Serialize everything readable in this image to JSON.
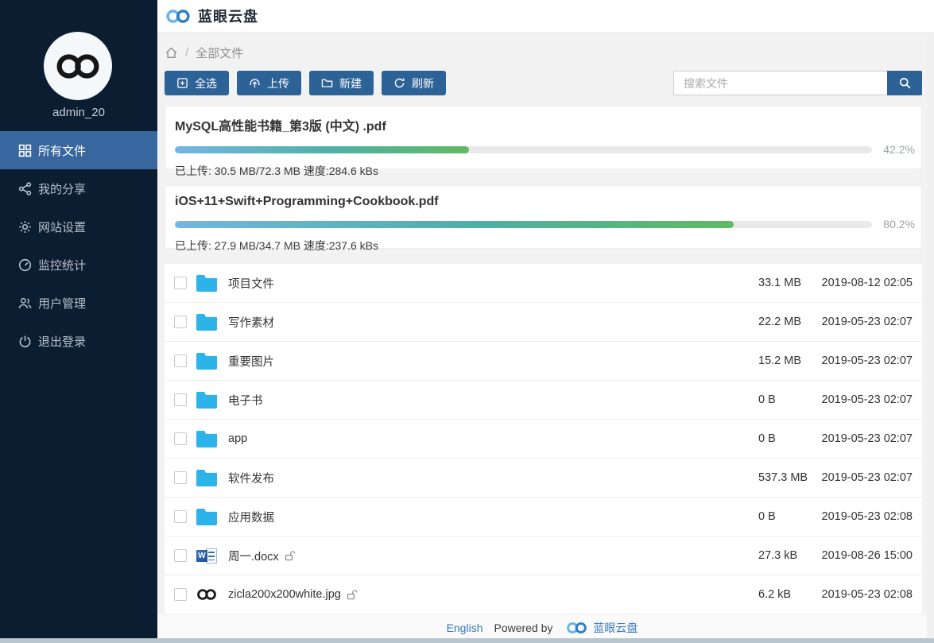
{
  "app": {
    "title": "蓝眼云盘"
  },
  "sidebar": {
    "username": "admin_20",
    "items": [
      {
        "id": "all-files",
        "label": "所有文件",
        "icon": "grid-icon",
        "active": true
      },
      {
        "id": "my-shares",
        "label": "我的分享",
        "icon": "share-icon"
      },
      {
        "id": "site-settings",
        "label": "网站设置",
        "icon": "gear-icon"
      },
      {
        "id": "monitor-stats",
        "label": "监控统计",
        "icon": "gauge-icon"
      },
      {
        "id": "user-management",
        "label": "用户管理",
        "icon": "users-icon"
      },
      {
        "id": "logout",
        "label": "退出登录",
        "icon": "power-icon"
      }
    ]
  },
  "breadcrumb": {
    "separator": "/",
    "current": "全部文件"
  },
  "toolbar": {
    "select_all": "全选",
    "upload": "上传",
    "create": "新建",
    "refresh": "刷新"
  },
  "search": {
    "placeholder": "搜索文件"
  },
  "uploads": [
    {
      "filename": "MySQL高性能书籍_第3版 (中文) .pdf",
      "percent": "42.2%",
      "percent_value": 42.2,
      "status": "已上传: 30.5 MB/72.3 MB 速度:284.6 kBs"
    },
    {
      "filename": "iOS+11+Swift+Programming+Cookbook.pdf",
      "percent": "80.2%",
      "percent_value": 80.2,
      "status": "已上传: 27.9 MB/34.7 MB 速度:237.6 kBs"
    }
  ],
  "files": [
    {
      "name": "项目文件",
      "type": "folder",
      "size": "33.1 MB",
      "modified": "2019-08-12 02:05"
    },
    {
      "name": "写作素材",
      "type": "folder",
      "size": "22.2 MB",
      "modified": "2019-05-23 02:07"
    },
    {
      "name": "重要图片",
      "type": "folder",
      "size": "15.2 MB",
      "modified": "2019-05-23 02:07"
    },
    {
      "name": "电子书",
      "type": "folder",
      "size": "0 B",
      "modified": "2019-05-23 02:07"
    },
    {
      "name": "app",
      "type": "folder",
      "size": "0 B",
      "modified": "2019-05-23 02:07"
    },
    {
      "name": "软件发布",
      "type": "folder",
      "size": "537.3 MB",
      "modified": "2019-05-23 02:07"
    },
    {
      "name": "应用数据",
      "type": "folder",
      "size": "0 B",
      "modified": "2019-05-23 02:08"
    },
    {
      "name": "周一.docx",
      "type": "docx",
      "size": "27.3 kB",
      "modified": "2019-08-26 15:00",
      "shared": true
    },
    {
      "name": "zicla200x200white.jpg",
      "type": "image",
      "size": "6.2 kB",
      "modified": "2019-05-23 02:08",
      "shared": true
    }
  ],
  "footer": {
    "language_link": "English",
    "powered_by": "Powered by",
    "brand": "蓝眼云盘"
  },
  "icons": {
    "logo": "infinity-loops",
    "folder": "blue-folder",
    "docx_badge": "W",
    "unlock": "open-padlock",
    "search": "magnifier"
  },
  "colors": {
    "sidebar_bg": "#0b1d31",
    "sidebar_active": "#38669f",
    "button_blue": "#2d6296",
    "folder_blue": "#2cb3ea",
    "link_blue": "#3779bd",
    "bottom_strip": "#b9c6cf",
    "progress_gradient": [
      "#74b6e2",
      "#4db0a4",
      "#60ba62"
    ],
    "logo_light_blue": "#66b5e5",
    "logo_dark_blue": "#2e80c4"
  }
}
